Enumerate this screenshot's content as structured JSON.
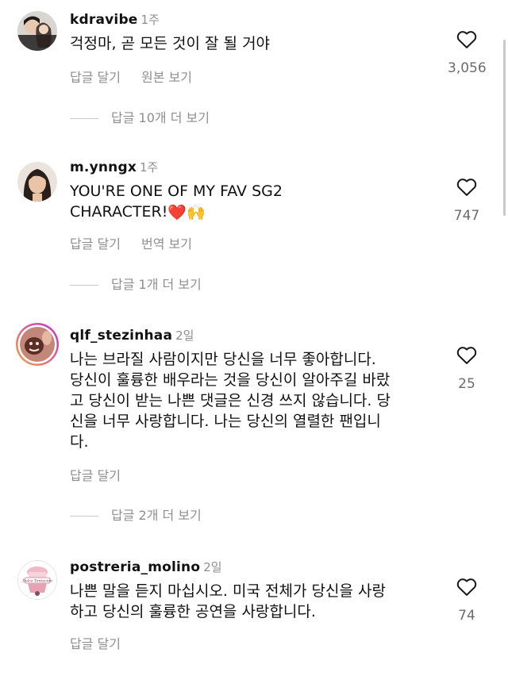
{
  "comments": [
    {
      "username": "kdravibe",
      "time": "1주",
      "lines": [
        "걱정마, 곧 모든 것이 잘 될 거야"
      ],
      "reply_label": "답글 달기",
      "extra_label": "원본 보기",
      "likes": "3,056",
      "more_replies": "답글 10개 더 보기"
    },
    {
      "username": "m.ynngx",
      "time": "1주",
      "lines": [
        "YOU'RE ONE OF MY FAV SG2",
        "CHARACTER!"
      ],
      "emoji": "❤️🙌",
      "reply_label": "답글 달기",
      "extra_label": "번역 보기",
      "likes": "747",
      "more_replies": "답글 1개 더 보기"
    },
    {
      "username": "qlf_stezinhaa",
      "time": "2일",
      "lines": [
        "나는 브라질 사람이지만 당신을 너무 좋아합니다.",
        "당신이 훌륭한 배우라는 것을 당신이 알아주길 바랐",
        "고 당신이 받는 나쁜 댓글은 신경 쓰지 않습니다. 당",
        "신을 너무 사랑합니다. 나는 당신의 열렬한 팬입니",
        "다."
      ],
      "reply_label": "답글 달기",
      "likes": "25",
      "more_replies": "답글 2개 더 보기"
    },
    {
      "username": "postreria_molino",
      "time": "2일",
      "lines": [
        "나쁜 말을 듣지 마십시오. 미국 전체가 당신을 사랑",
        "하고 당신의 훌륭한 공연을 사랑합니다."
      ],
      "reply_label": "답글 달기",
      "likes": "74",
      "avatar_text": "Dulce Tentación"
    }
  ],
  "colors": {
    "heart": "#1a1a1a",
    "secondary": "#8e8e8e",
    "story_ring_start": "#f9a03f",
    "story_ring_end": "#c62ccf"
  },
  "icons": {
    "like": "heart-outline-icon"
  }
}
